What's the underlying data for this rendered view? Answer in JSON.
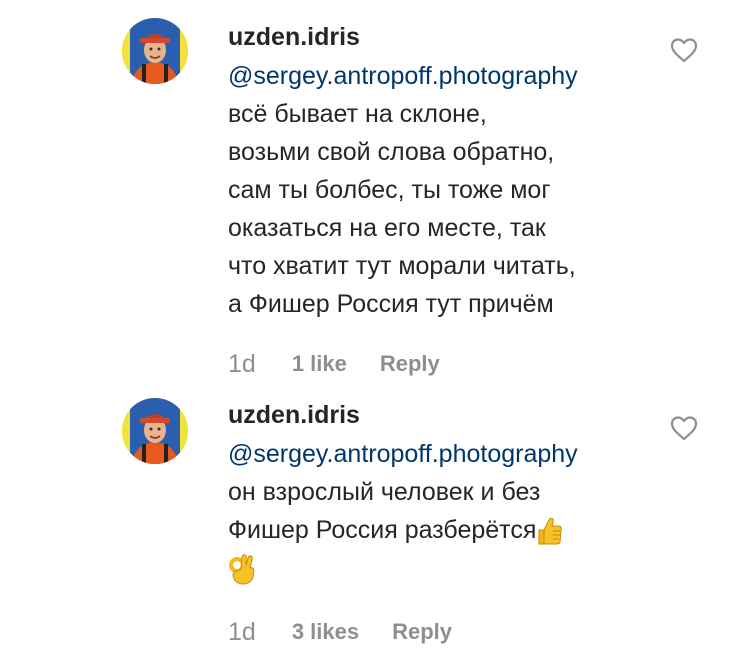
{
  "comments": [
    {
      "username": "uzden.idris",
      "mention": "@sergey.antropoff.photography",
      "lines": [
        "всё бывает на склоне,",
        "возьми свой слова обратно,",
        "сам ты болбес, ты тоже мог",
        "оказаться на его месте, так",
        "что хватит тут морали читать,",
        "а Фишер Россия тут причём"
      ],
      "time": "1d",
      "likes": "1 like",
      "reply": "Reply",
      "icons": {
        "like": "heart-outline-icon",
        "avatar": "avatar-photo"
      }
    },
    {
      "username": "uzden.idris",
      "mention": "@sergey.antropoff.photography",
      "lines": [
        "он взрослый человек и без",
        "Фишер Россия разберётся"
      ],
      "emojis": [
        "thumbs-up-emoji",
        "ok-hand-emoji"
      ],
      "time": "1d",
      "likes": "3 likes",
      "reply": "Reply",
      "icons": {
        "like": "heart-outline-icon",
        "avatar": "avatar-photo"
      }
    }
  ],
  "colors": {
    "text": "#262626",
    "mention": "#00376b",
    "meta": "#8e8e8e",
    "emoji": "#f5b51b"
  }
}
